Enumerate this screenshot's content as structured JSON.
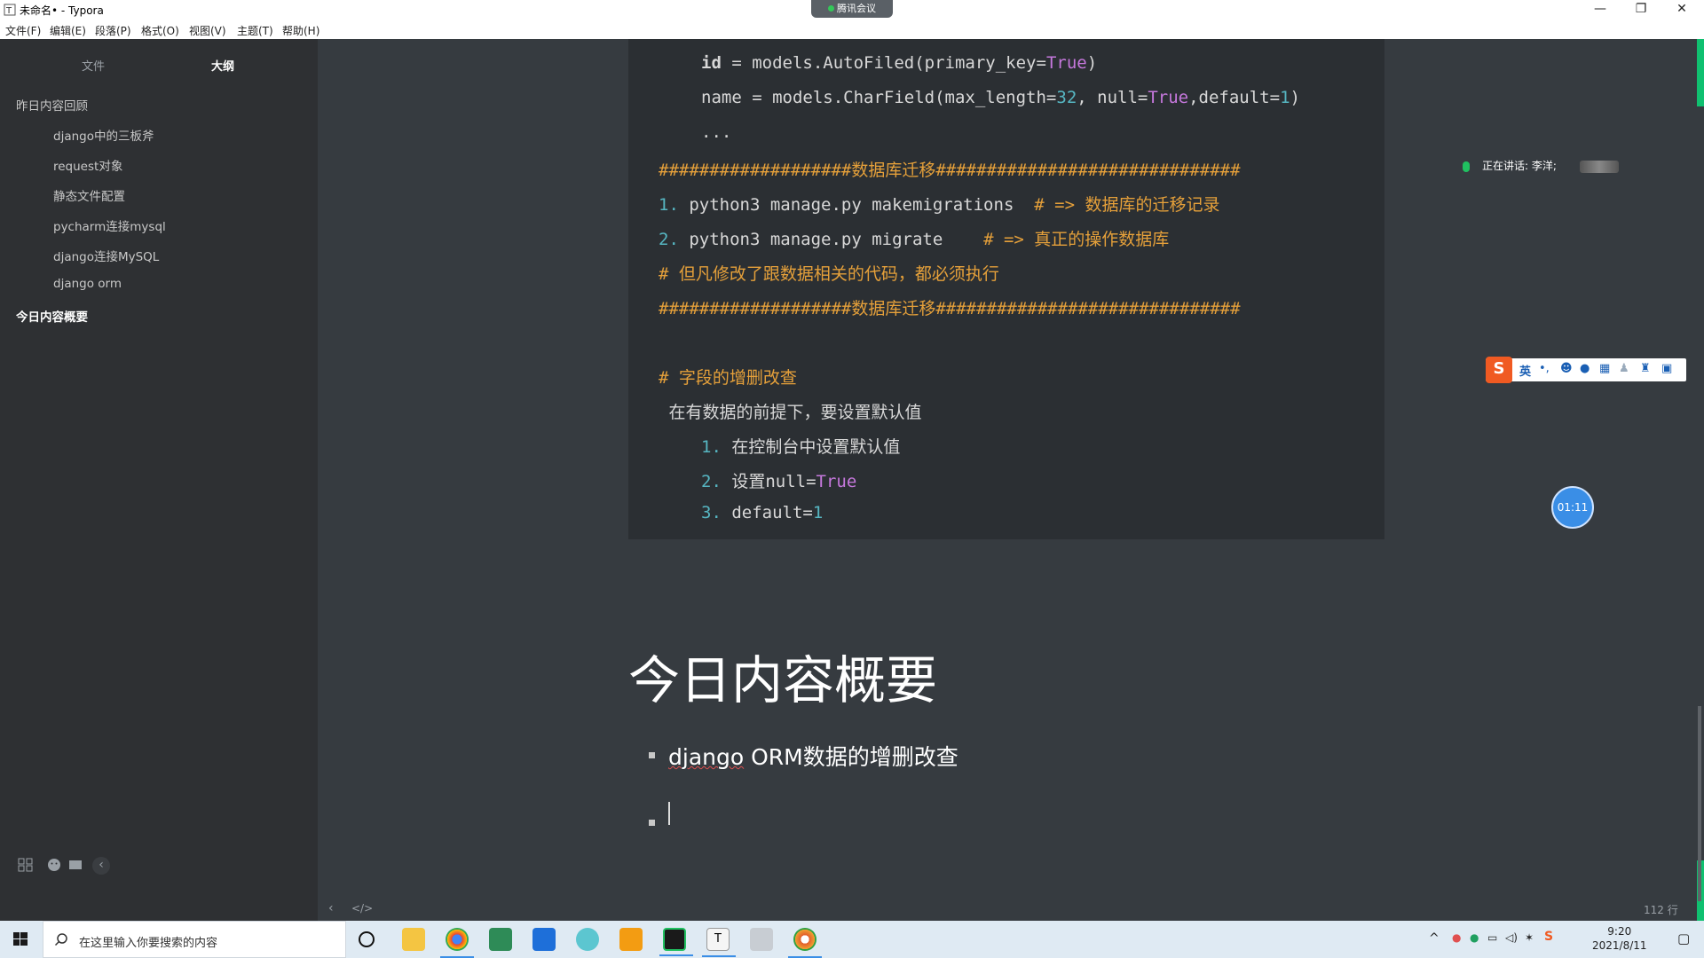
{
  "window": {
    "title": "未命名• - Typora",
    "meeting_label": "腾讯会议",
    "minimize": "—",
    "maximize": "❐",
    "close": "✕"
  },
  "menu": [
    "文件(F)",
    "编辑(E)",
    "段落(P)",
    "格式(O)",
    "视图(V)",
    "主题(T)",
    "帮助(H)"
  ],
  "sidebar": {
    "tabs": [
      "文件",
      "大纲"
    ],
    "active_tab": "大纲",
    "outline": [
      {
        "label": "昨日内容回顾",
        "level": 1
      },
      {
        "label": "django中的三板斧",
        "level": 2
      },
      {
        "label": "request对象",
        "level": 2
      },
      {
        "label": "静态文件配置",
        "level": 2
      },
      {
        "label": "pycharm连接mysql",
        "level": 2
      },
      {
        "label": "django连接MySQL",
        "level": 2
      },
      {
        "label": "django orm",
        "level": 2
      },
      {
        "label": "今日内容概要",
        "level": 1,
        "active": true
      }
    ]
  },
  "code": {
    "line1_indent": "    ",
    "line1_a": "id",
    "line1_b": " = models.AutoFiled(primary_key=",
    "line1_c": "True",
    "line1_d": ")",
    "line2_a": "name = models.CharField(max_length=",
    "line2_b": "32",
    "line2_c": ", null=",
    "line2_d": "True",
    "line2_e": ",default=",
    "line2_f": "1",
    "line2_g": ")",
    "line3": "...",
    "hash_line": "###################数据库迁移##############################",
    "step1_num": "1.",
    "step1_code": " python3 manage.py makemigrations  ",
    "step1_comment": "# => 数据库的迁移记录",
    "step2_num": "2.",
    "step2_code": " python3 manage.py migrate    ",
    "step2_comment": "# => 真正的操作数据库",
    "note": "# 但凡修改了跟数据相关的代码，都必须执行",
    "hash_line2": "###################数据库迁移##############################",
    "section": "# 字段的增删改查",
    "premise": " 在有数据的前提下，要设置默认值",
    "opt1_num": "1.",
    "opt1_text": " 在控制台中设置默认值",
    "opt2_num": "2.",
    "opt2_text": " 设置null=",
    "opt2_true": "True",
    "opt3_num": "3.",
    "opt3_text": " default=",
    "opt3_val": "1"
  },
  "heading": "今日内容概要",
  "list_item_1_a": "django",
  "list_item_1_b": " ORM数据的增删改查",
  "status": {
    "lines": "112 行",
    "prev": "‹",
    "source": "</>"
  },
  "overlay": {
    "speaking": "正在讲话: 李洋;",
    "timer": "01:11",
    "ime_lang": "英"
  },
  "taskbar": {
    "search_placeholder": "在这里输入你要搜索的内容",
    "time": "9:20",
    "date": "2021/8/11"
  },
  "colors": {
    "accent_green": "#10c070",
    "editor_bg": "#363b40",
    "code_bg": "#2b2f33",
    "comment": "#e5a03a"
  }
}
